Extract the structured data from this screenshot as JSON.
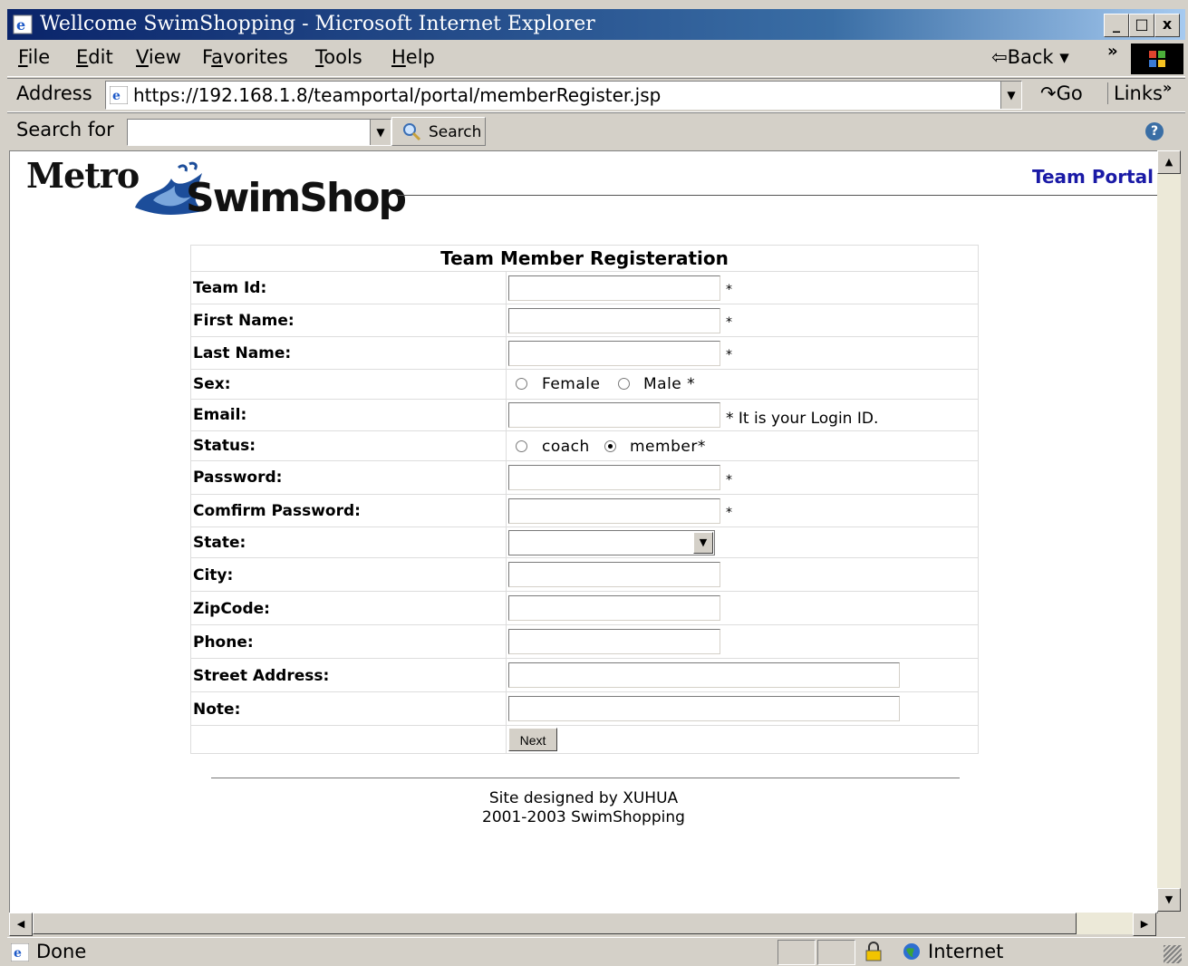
{
  "window": {
    "title": "Wellcome SwimShopping - Microsoft Internet Explorer",
    "controls": [
      "_",
      "□",
      "x"
    ]
  },
  "menubar": {
    "items": [
      {
        "label": "File",
        "ul": "F",
        "rest": "ile"
      },
      {
        "label": "Edit",
        "ul": "E",
        "rest": "dit"
      },
      {
        "label": "View",
        "ul": "V",
        "rest": "iew"
      },
      {
        "label": "Favorites",
        "pre": "F",
        "ul": "a",
        "rest": "vorites"
      },
      {
        "label": "Tools",
        "ul": "T",
        "rest": "ools"
      },
      {
        "label": "Help",
        "ul": "H",
        "rest": "elp"
      }
    ],
    "back_label": "⇦Back ▾",
    "chevron": "»"
  },
  "addressbar": {
    "label": "Address",
    "url": "https://192.168.1.8/teamportal/portal/memberRegister.jsp",
    "go_label": "Go",
    "links_label": "Links"
  },
  "searchbar": {
    "label": "Search for",
    "input_value": "",
    "button_label": "Search"
  },
  "page": {
    "logo_top": "Metro",
    "logo_bottom": "SwimShop",
    "team_portal_link": "Team Portal",
    "form": {
      "title": "Team Member Registeration",
      "labels": {
        "team_id": "Team Id:",
        "first_name": "First Name:",
        "last_name": "Last Name:",
        "sex": "Sex:",
        "email": "Email:",
        "status": "Status:",
        "password": "Password:",
        "confirm_password": "Comfirm Password:",
        "state": "State:",
        "city": "City:",
        "zipcode": "ZipCode:",
        "phone": "Phone:",
        "street_address": "Street Address:",
        "note": "Note:"
      },
      "values": {
        "team_id": "",
        "first_name": "",
        "last_name": "",
        "email": "",
        "password": "",
        "confirm_password": "",
        "state": "",
        "city": "",
        "zipcode": "",
        "phone": "",
        "street_address": "",
        "note": ""
      },
      "required_mark": "*",
      "sex_options": {
        "female": "Female",
        "male": "Male *"
      },
      "sex_selected": "",
      "email_hint": "* It is your Login ID.",
      "status_options": {
        "coach": "coach",
        "member": "member*"
      },
      "status_selected": "member",
      "next_button": "Next"
    },
    "footer": {
      "line1": "Site designed by XUHUA",
      "line2": "2001-2003 SwimShopping"
    }
  },
  "statusbar": {
    "text": "Done",
    "zone": "Internet"
  }
}
